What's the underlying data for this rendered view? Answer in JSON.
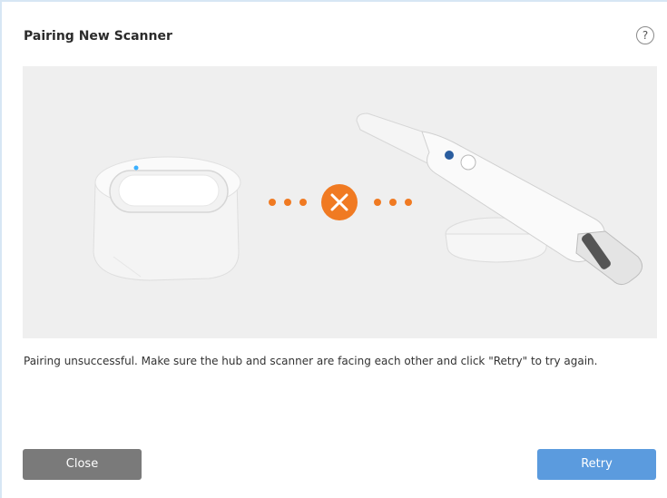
{
  "dialog": {
    "title": "Pairing New Scanner",
    "help_label": "?",
    "message": "Pairing unsuccessful. Make sure the hub and scanner are facing each other and click \"Retry\" to try again.",
    "close_label": "Close",
    "retry_label": "Retry"
  },
  "colors": {
    "accent_error": "#f07a22",
    "retry_button": "#5b9bde",
    "close_button": "#7a7a7a"
  },
  "icons": {
    "help": "question-circle-icon",
    "status": "x-circle-icon"
  }
}
